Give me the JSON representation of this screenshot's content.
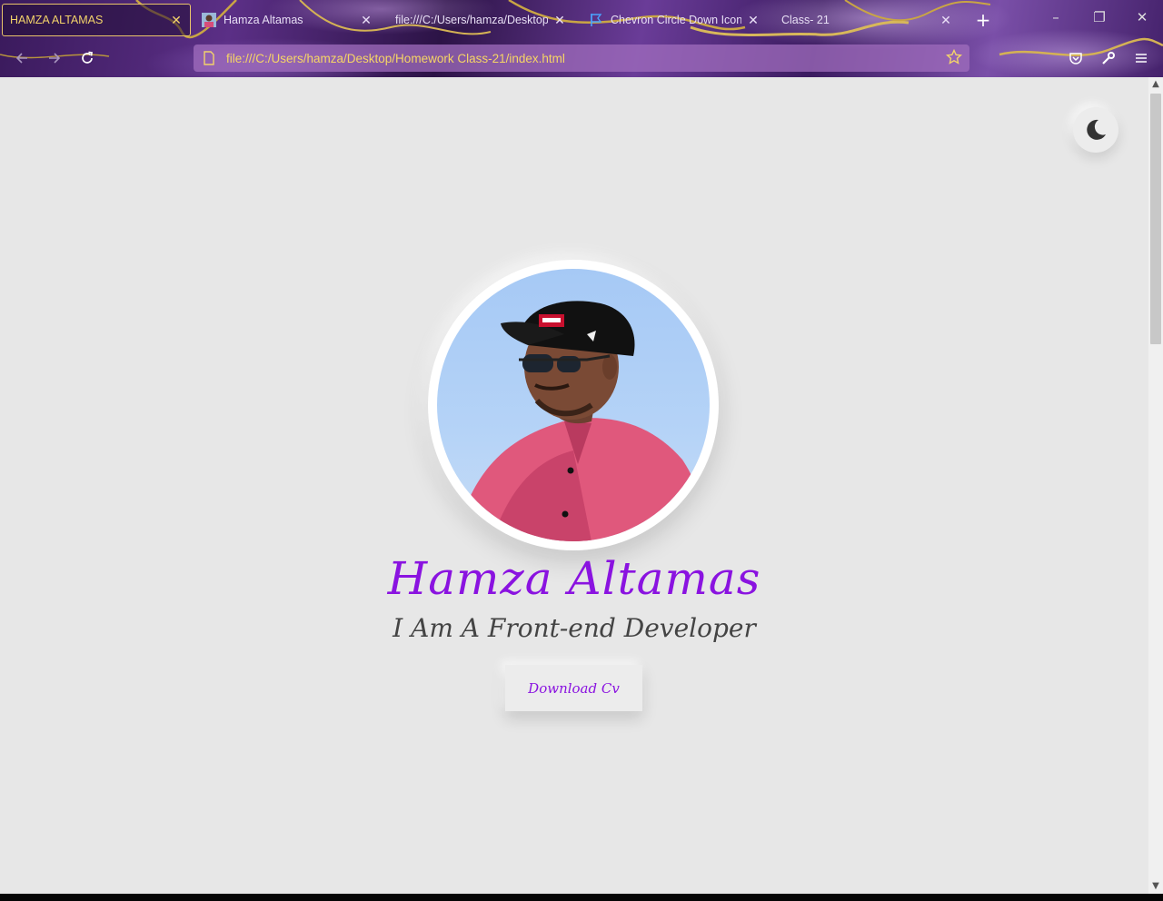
{
  "browser": {
    "tabs": [
      {
        "title": "HAMZA ALTAMAS",
        "active": true
      },
      {
        "title": "Hamza Altamas",
        "active": false
      },
      {
        "title": "file:///C:/Users/hamza/Desktop/",
        "active": false
      },
      {
        "title": "Chevron Circle Down Icon | F",
        "active": false
      },
      {
        "title": "Class- 21",
        "active": false
      }
    ],
    "url": "file:///C:/Users/hamza/Desktop/Homework Class-21/index.html",
    "accent_color": "#f3d36a"
  },
  "page": {
    "name": "Hamza Altamas",
    "tagline": "I Am A Front-end Developer",
    "cta_label": "Download Cv",
    "name_color": "#8a13e0",
    "background": "#e7e7e7",
    "theme_toggle_icon": "moon-icon"
  }
}
